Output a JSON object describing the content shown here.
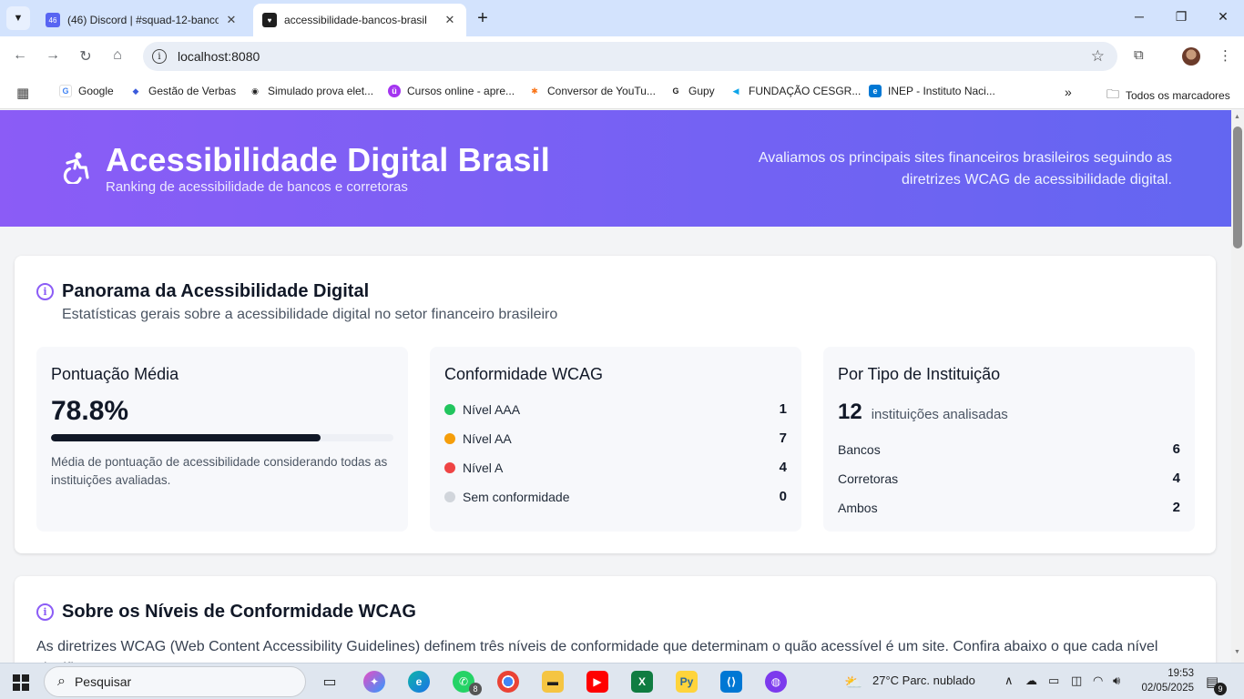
{
  "browser": {
    "tabs": [
      {
        "title": "(46) Discord | #squad-12-banco",
        "badge": "46"
      },
      {
        "title": "accessibilidade-bancos-brasil"
      }
    ],
    "url": "localhost:8080",
    "bookmarks": [
      {
        "label": "Google",
        "icon": "google-icon",
        "color": "#4285f4",
        "glyph": "G"
      },
      {
        "label": "Gestão de Verbas",
        "icon": "diamond-icon",
        "color": "#3b5bdb",
        "glyph": "◆"
      },
      {
        "label": "Simulado prova elet...",
        "icon": "globe-icon",
        "color": "#222222",
        "glyph": "◉"
      },
      {
        "label": "Cursos online - apre...",
        "icon": "udemy-icon",
        "color": "#a435f0",
        "glyph": "ü"
      },
      {
        "label": "Conversor de YouTu...",
        "icon": "waveform-icon",
        "color": "#f97316",
        "glyph": "✱"
      },
      {
        "label": "Gupy",
        "icon": "gupy-icon",
        "color": "#1f1f1f",
        "glyph": "G"
      },
      {
        "label": "FUNDAÇÃO CESGR...",
        "icon": "arrow-icon",
        "color": "#0ea5e9",
        "glyph": "◀"
      },
      {
        "label": "INEP - Instituto Naci...",
        "icon": "edge-icon",
        "color": "#0078d4",
        "glyph": "e"
      }
    ],
    "all_bookmarks": "Todos os marcadores"
  },
  "hero": {
    "title": "Acessibilidade Digital Brasil",
    "subtitle": "Ranking de acessibilidade de bancos e corretoras",
    "description": "Avaliamos os principais sites financeiros brasileiros seguindo as diretrizes WCAG de acessibilidade digital."
  },
  "panorama": {
    "title": "Panorama da Acessibilidade Digital",
    "subtitle": "Estatísticas gerais sobre a acessibilidade digital no setor financeiro brasileiro",
    "score": {
      "heading": "Pontuação Média",
      "value": "78.8%",
      "fraction": 0.788,
      "note": "Média de pontuação de acessibilidade considerando todas as instituições avaliadas."
    },
    "wcag": {
      "heading": "Conformidade WCAG",
      "levels": [
        {
          "label": "Nível AAA",
          "count": "1",
          "color": "#22c55e"
        },
        {
          "label": "Nível AA",
          "count": "7",
          "color": "#f59e0b"
        },
        {
          "label": "Nível A",
          "count": "4",
          "color": "#ef4444"
        },
        {
          "label": "Sem conformidade",
          "count": "0",
          "color": "#d1d5db"
        }
      ]
    },
    "types": {
      "heading": "Por Tipo de Instituição",
      "total": "12",
      "total_label": "instituições analisadas",
      "items": [
        {
          "label": "Bancos",
          "count": "6"
        },
        {
          "label": "Corretoras",
          "count": "4"
        },
        {
          "label": "Ambos",
          "count": "2"
        }
      ]
    }
  },
  "about": {
    "title": "Sobre os Níveis de Conformidade WCAG",
    "text": "As diretrizes WCAG (Web Content Accessibility Guidelines) definem três níveis de conformidade que determinam o quão acessível é um site. Confira abaixo o que cada nível significa:"
  },
  "taskbar": {
    "search_placeholder": "Pesquisar",
    "whatsapp_badge": "8",
    "weather": "27°C  Parc. nublado",
    "time": "19:53",
    "date": "02/05/2025",
    "notifications": "9"
  }
}
